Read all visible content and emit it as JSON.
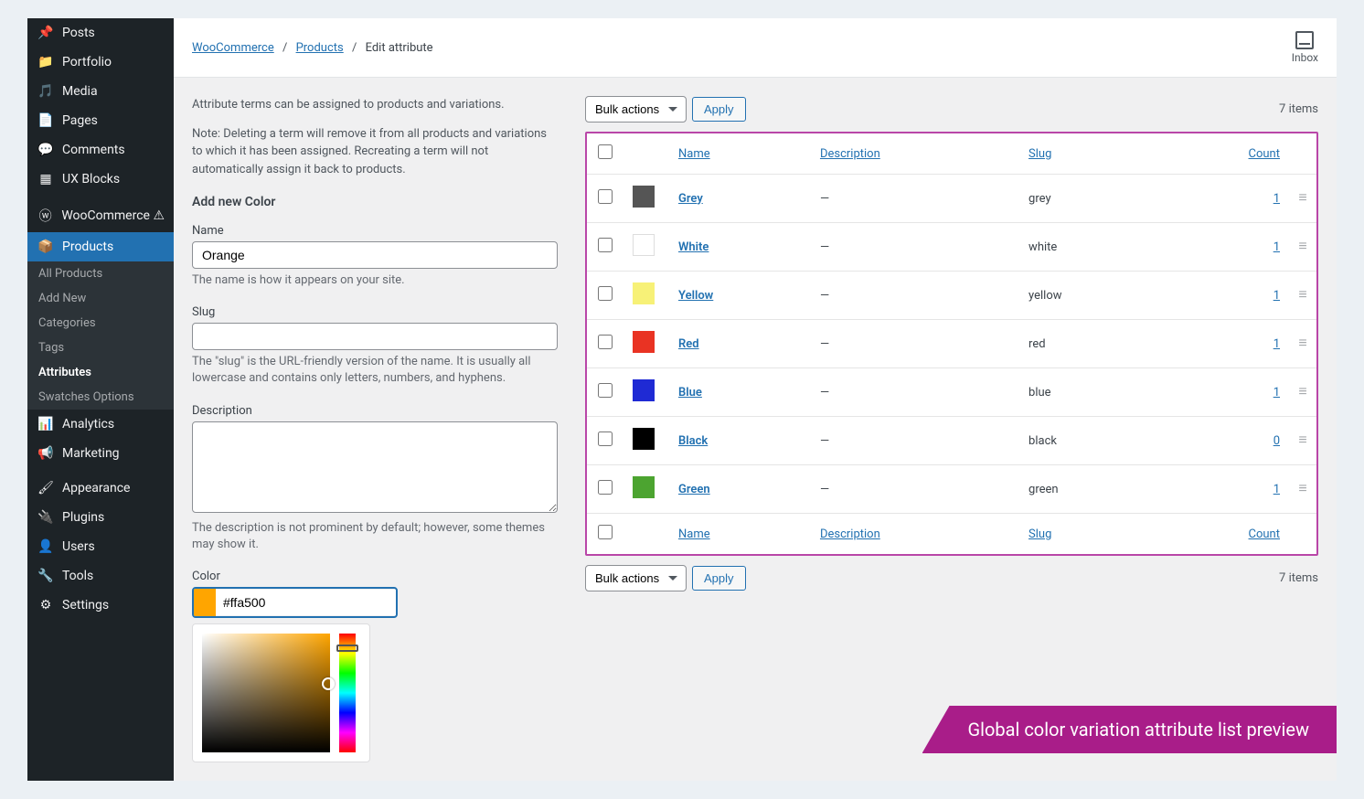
{
  "sidebar": {
    "items": [
      {
        "label": "Posts",
        "icon": "pin"
      },
      {
        "label": "Portfolio",
        "icon": "folder"
      },
      {
        "label": "Media",
        "icon": "media"
      },
      {
        "label": "Pages",
        "icon": "page"
      },
      {
        "label": "Comments",
        "icon": "comment"
      },
      {
        "label": "UX Blocks",
        "icon": "blocks"
      }
    ],
    "woo": {
      "label": "WooCommerce"
    },
    "products": {
      "label": "Products"
    },
    "sub": [
      {
        "label": "All Products"
      },
      {
        "label": "Add New"
      },
      {
        "label": "Categories"
      },
      {
        "label": "Tags"
      },
      {
        "label": "Attributes"
      },
      {
        "label": "Swatches Options"
      }
    ],
    "items2": [
      {
        "label": "Analytics",
        "icon": "chart"
      },
      {
        "label": "Marketing",
        "icon": "megaphone"
      }
    ],
    "items3": [
      {
        "label": "Appearance",
        "icon": "brush"
      },
      {
        "label": "Plugins",
        "icon": "plug"
      },
      {
        "label": "Users",
        "icon": "user"
      },
      {
        "label": "Tools",
        "icon": "wrench"
      },
      {
        "label": "Settings",
        "icon": "gear"
      }
    ]
  },
  "breadcrumb": {
    "woo": "WooCommerce",
    "products": "Products",
    "current": "Edit attribute"
  },
  "inbox_label": "Inbox",
  "intro": "Attribute terms can be assigned to products and variations.",
  "note": "Note: Deleting a term will remove it from all products and variations to which it has been assigned. Recreating a term will not automatically assign it back to products.",
  "form": {
    "heading": "Add new Color",
    "name_label": "Name",
    "name_value": "Orange",
    "name_help": "The name is how it appears on your site.",
    "slug_label": "Slug",
    "slug_value": "",
    "slug_help": "The \"slug\" is the URL-friendly version of the name. It is usually all lowercase and contains only letters, numbers, and hyphens.",
    "desc_label": "Description",
    "desc_value": "",
    "desc_help": "The description is not prominent by default; however, some themes may show it.",
    "color_label": "Color",
    "color_value": "#ffa500"
  },
  "bulk": {
    "select": "Bulk actions",
    "apply": "Apply",
    "count": "7 items"
  },
  "headers": {
    "name": "Name",
    "desc": "Description",
    "slug": "Slug",
    "count": "Count"
  },
  "rows": [
    {
      "color": "#555",
      "name": "Grey",
      "desc": "—",
      "slug": "grey",
      "count": "1"
    },
    {
      "color": "#fff",
      "name": "White",
      "desc": "—",
      "slug": "white",
      "count": "1"
    },
    {
      "color": "#f7f177",
      "name": "Yellow",
      "desc": "—",
      "slug": "yellow",
      "count": "1"
    },
    {
      "color": "#e93323",
      "name": "Red",
      "desc": "—",
      "slug": "red",
      "count": "1"
    },
    {
      "color": "#1f2ad4",
      "name": "Blue",
      "desc": "—",
      "slug": "blue",
      "count": "1"
    },
    {
      "color": "#000",
      "name": "Black",
      "desc": "—",
      "slug": "black",
      "count": "0"
    },
    {
      "color": "#4ca430",
      "name": "Green",
      "desc": "—",
      "slug": "green",
      "count": "1"
    }
  ],
  "banner": "Global color variation attribute list preview"
}
